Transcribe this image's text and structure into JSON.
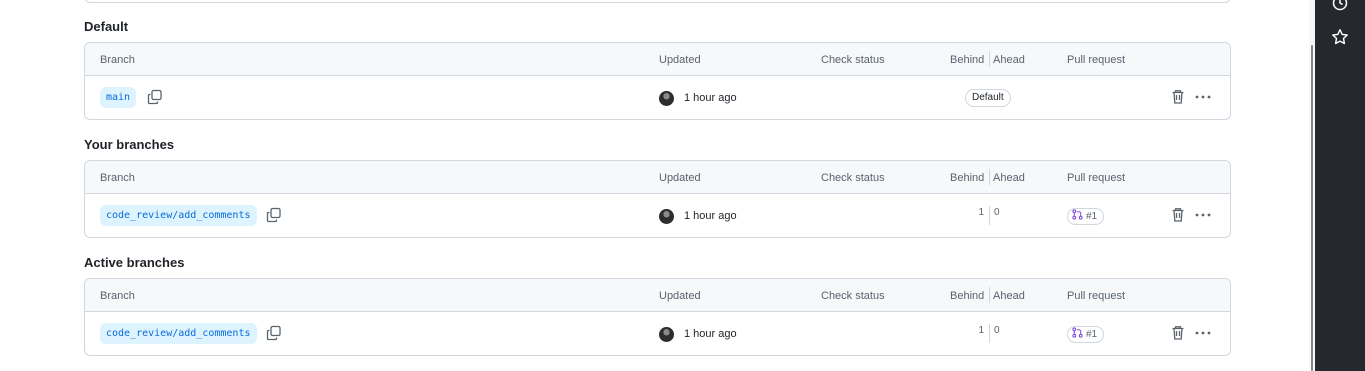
{
  "columns": {
    "branch": "Branch",
    "updated": "Updated",
    "check_status": "Check status",
    "behind": "Behind",
    "ahead": "Ahead",
    "pull_request": "Pull request"
  },
  "sections": {
    "default": {
      "title": "Default",
      "row": {
        "branch": "main",
        "updated": "1 hour ago",
        "badge": "Default"
      }
    },
    "yours": {
      "title": "Your branches",
      "row": {
        "branch": "code_review/add_comments",
        "updated": "1 hour ago",
        "behind": "1",
        "ahead": "0",
        "pr": "#1"
      }
    },
    "active": {
      "title": "Active branches",
      "row": {
        "branch": "code_review/add_comments",
        "updated": "1 hour ago",
        "behind": "1",
        "ahead": "0",
        "pr": "#1"
      }
    }
  },
  "icons": {
    "copy": "copy-icon",
    "trash": "trash-icon",
    "kebab": "kebab-horizontal-icon",
    "pull_request": "git-pull-request-icon",
    "clock": "clock-icon",
    "star": "star-icon"
  },
  "colors": {
    "branch_pill_bg": "#ddf4ff",
    "branch_pill_text": "#0969da",
    "pr_icon": "#8250df",
    "rail_bg": "#25282d"
  }
}
